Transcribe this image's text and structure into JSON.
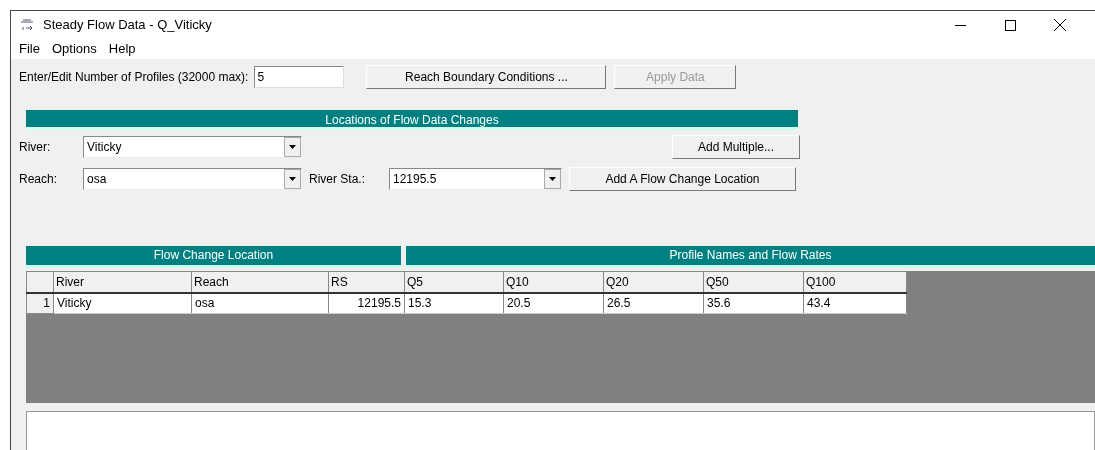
{
  "window": {
    "title": "Steady Flow Data - Q_Viticky"
  },
  "menu": [
    "File",
    "Options",
    "Help"
  ],
  "profiles": {
    "label": "Enter/Edit Number of Profiles (32000 max):",
    "value": "5"
  },
  "top_buttons": [
    {
      "label": "Reach Boundary Conditions ...",
      "disabled": false
    },
    {
      "label": "Apply Data",
      "disabled": true
    }
  ],
  "locations": {
    "title": "Locations of Flow Data Changes",
    "river": {
      "label": "River:",
      "value": "Viticky"
    },
    "reach": {
      "label": "Reach:",
      "value": "osa"
    },
    "river_station": {
      "label": "River Sta.:",
      "value": "12195.5"
    },
    "add_multiple": "Add Multiple...",
    "add_location": "Add A Flow Change Location"
  },
  "table": {
    "group_headers": [
      "Flow Change Location",
      "Profile Names and Flow Rates"
    ],
    "columns": [
      "River",
      "Reach",
      "RS",
      "Q5",
      "Q10",
      "Q20",
      "Q50",
      "Q100"
    ],
    "rows": [
      {
        "number": "1",
        "cells": [
          "Viticky",
          "osa",
          "12195.5",
          "15.3",
          "20.5",
          "26.5",
          "35.6",
          "43.4"
        ]
      }
    ]
  }
}
